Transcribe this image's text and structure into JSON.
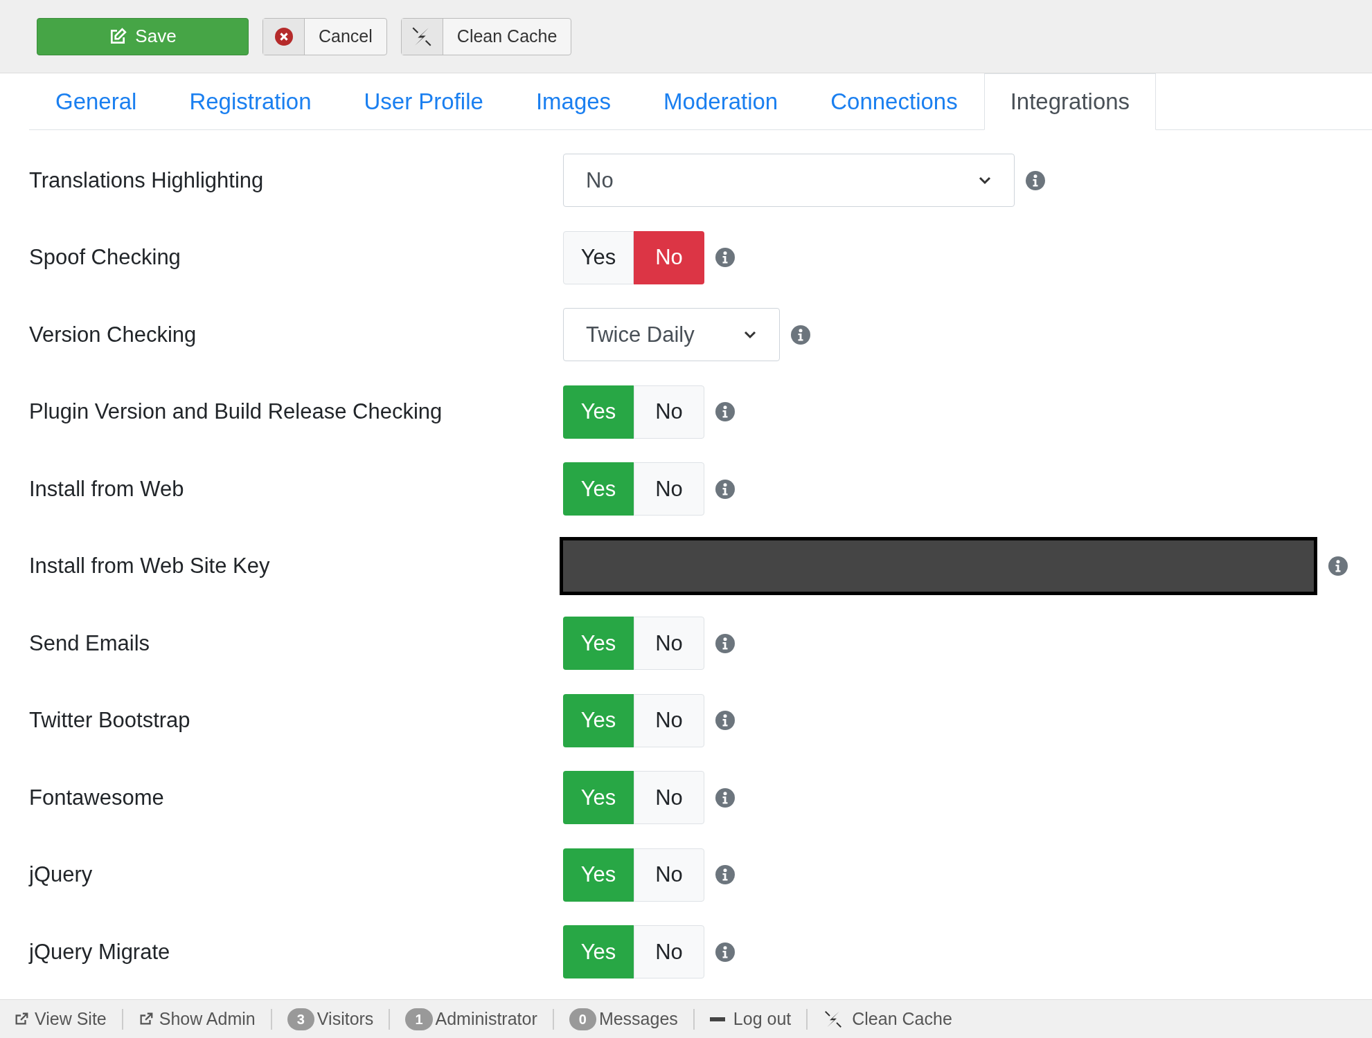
{
  "toolbar": {
    "buttons": [
      {
        "kind": "save",
        "label": "Save"
      },
      {
        "kind": "cancel",
        "label": "Cancel"
      },
      {
        "kind": "cache",
        "label": "Clean Cache"
      }
    ]
  },
  "tabs": [
    {
      "label": "General",
      "selected": false
    },
    {
      "label": "Registration",
      "selected": false
    },
    {
      "label": "User Profile",
      "selected": false
    },
    {
      "label": "Images",
      "selected": false
    },
    {
      "label": "Moderation",
      "selected": false
    },
    {
      "label": "Connections",
      "selected": false
    },
    {
      "label": "Integrations",
      "selected": true
    }
  ],
  "settings": [
    {
      "label": "Translations Highlighting",
      "kind": "select",
      "value": "No"
    },
    {
      "label": "Spoof Checking",
      "kind": "toggle",
      "options": [
        {
          "label": "Yes",
          "selected": false
        },
        {
          "label": "No",
          "selected": true
        }
      ]
    },
    {
      "label": "Version Checking",
      "kind": "dropdown",
      "value": "Twice Daily"
    },
    {
      "label": "Plugin Version and Build Release Checking",
      "kind": "toggle",
      "options": [
        {
          "label": "Yes",
          "selected": true
        },
        {
          "label": "No",
          "selected": false
        }
      ]
    },
    {
      "label": "Install from Web",
      "kind": "toggle",
      "options": [
        {
          "label": "Yes",
          "selected": true
        },
        {
          "label": "No",
          "selected": false
        }
      ]
    },
    {
      "label": "Install from Web Site Key",
      "kind": "redacted"
    },
    {
      "label": "Send Emails",
      "kind": "toggle",
      "options": [
        {
          "label": "Yes",
          "selected": true
        },
        {
          "label": "No",
          "selected": false
        }
      ]
    },
    {
      "label": "Twitter Bootstrap",
      "kind": "toggle",
      "options": [
        {
          "label": "Yes",
          "selected": true
        },
        {
          "label": "No",
          "selected": false
        }
      ]
    },
    {
      "label": "Fontawesome",
      "kind": "toggle",
      "options": [
        {
          "label": "Yes",
          "selected": true
        },
        {
          "label": "No",
          "selected": false
        }
      ]
    },
    {
      "label": "jQuery",
      "kind": "toggle",
      "options": [
        {
          "label": "Yes",
          "selected": true
        },
        {
          "label": "No",
          "selected": false
        }
      ]
    },
    {
      "label": "jQuery Migrate",
      "kind": "toggle",
      "options": [
        {
          "label": "Yes",
          "selected": true
        },
        {
          "label": "No",
          "selected": false
        }
      ]
    }
  ],
  "status_bar": [
    {
      "kind": "link",
      "label": "View Site"
    },
    {
      "kind": "link",
      "label": "Show Admin"
    },
    {
      "kind": "count",
      "count": "3",
      "label": "Visitors"
    },
    {
      "kind": "count",
      "count": "1",
      "label": "Administrator"
    },
    {
      "kind": "count",
      "count": "0",
      "label": "Messages"
    },
    {
      "kind": "logout",
      "label": "Log out"
    },
    {
      "kind": "cache",
      "label": "Clean Cache"
    }
  ]
}
